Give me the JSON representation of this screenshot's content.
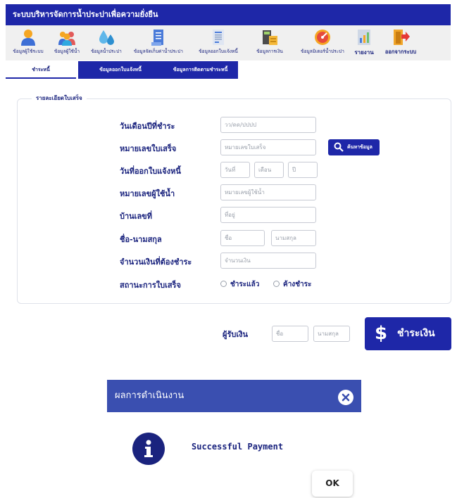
{
  "app": {
    "title": "ระบบบริหารจัดการน้ำประปาเพื่อความยั่งยืน"
  },
  "toolbar": {
    "items": [
      {
        "label": "ข้อมูลผู้ใช้ระบบ",
        "icon": "user-icon"
      },
      {
        "label": "ข้อมูลผู้ใช้น้ำ",
        "icon": "users-group-icon"
      },
      {
        "label": "ข้อมูลน้ำประปา",
        "icon": "water-drops-icon"
      },
      {
        "label": "ข้อมูลจัดเก็บค่าน้ำประปา",
        "icon": "document-icon"
      },
      {
        "label": "ข้อมูลออกใบแจ้งหนี้",
        "icon": "invoice-icon"
      },
      {
        "label": "ข้อมูลการเงิน",
        "icon": "calculator-money-icon"
      },
      {
        "label": "ข้อมูลมิเตอร์น้ำประปา",
        "icon": "meter-gauge-icon"
      },
      {
        "label": "รายงาน",
        "icon": "report-icon"
      },
      {
        "label": "ออกจากระบบ",
        "icon": "logout-door-icon"
      }
    ]
  },
  "tabs": [
    {
      "label": "ชำระหนี้",
      "active": true
    },
    {
      "label": "ข้อมูลออกใบแจ้งหนี้",
      "active": false
    },
    {
      "label": "ข้อมูลการติดตามชำระหนี้",
      "active": false
    }
  ],
  "form": {
    "section_title": "รายละเอียดใบเสร็จ",
    "payment_date_label": "วันเดือนปีที่ชำระ",
    "payment_date_placeholder": "วว/ดด/ปปปป",
    "receipt_no_label": "หมายเลขใบเสร็จ",
    "receipt_no_placeholder": "หมายเลขใบเสร็จ",
    "search_button": "ค้นหาข้อมูล",
    "invoice_date_label": "วันที่ออกใบแจ้งหนี้",
    "day_placeholder": "วันที่",
    "month_placeholder": "เดือน",
    "year_placeholder": "ปี",
    "user_no_label": "หมายเลขผู้ใช้น้ำ",
    "user_no_placeholder": "หมายเลขผู้ใช้น้ำ",
    "house_no_label": "บ้านเลขที่",
    "house_no_placeholder": "ที่อยู่",
    "fullname_label": "ชื่อ-นามสกุล",
    "firstname_placeholder": "ชื่อ",
    "lastname_placeholder": "นามสกุล",
    "amount_label": "จำนวนเงินที่ต้องชำระ",
    "amount_placeholder": "จำนวนเงิน",
    "status_label": "สถานะการใบเสร็จ",
    "status_paid": "ชำระแล้ว",
    "status_overdue": "ค้างชำระ"
  },
  "payer": {
    "label": "ผู้รับเงิน",
    "firstname_placeholder": "ชื่อ",
    "lastname_placeholder": "นามสกุล",
    "pay_button": "ชำระเงิน",
    "pay_icon": "$"
  },
  "dialog": {
    "title": "ผลการดำเนินงาน",
    "message": "Successful Payment",
    "ok_button": "OK"
  },
  "colors": {
    "primary": "#1e27a8",
    "dialog_header": "#3a4fb0",
    "text": "#1a237e"
  }
}
